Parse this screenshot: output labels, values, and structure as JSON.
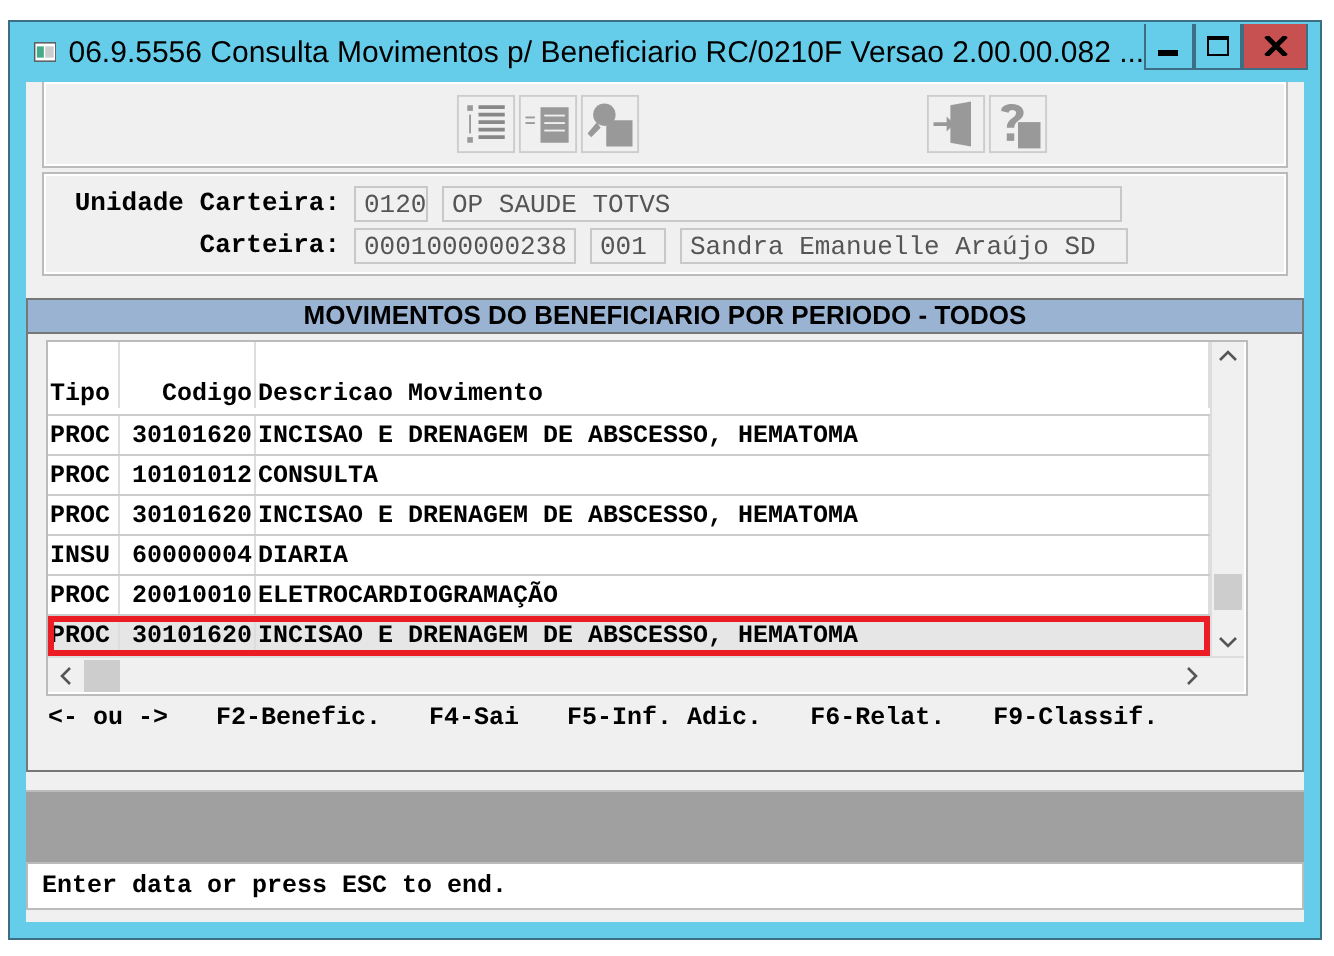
{
  "window": {
    "title": "06.9.5556 Consulta Movimentos p/ Beneficiario RC/0210F Versao 2.00.00.082 ..."
  },
  "fields": [
    {
      "label": "Unidade Carteira:",
      "values": [
        "0120",
        "OP SAUDE TOTVS"
      ]
    },
    {
      "label": "Carteira:",
      "values": [
        "0001000000238",
        "001",
        "Sandra Emanuelle Araújo SD"
      ]
    }
  ],
  "table": {
    "title": "MOVIMENTOS DO BENEFICIARIO POR PERIODO - TODOS",
    "columns": [
      "Tipo",
      "Codigo",
      "Descricao Movimento"
    ],
    "rows": [
      {
        "cells": [
          "PROC",
          "30101620",
          "INCISAO E DRENAGEM DE ABSCESSO, HEMATOMA"
        ],
        "selected": false
      },
      {
        "cells": [
          "PROC",
          "10101012",
          "CONSULTA"
        ],
        "selected": false
      },
      {
        "cells": [
          "PROC",
          "30101620",
          "INCISAO E DRENAGEM DE ABSCESSO, HEMATOMA"
        ],
        "selected": false
      },
      {
        "cells": [
          "INSU",
          "60000004",
          "DIARIA"
        ],
        "selected": false
      },
      {
        "cells": [
          "PROC",
          "20010010",
          "ELETROCARDIOGRAMAÇÃO"
        ],
        "selected": false
      },
      {
        "cells": [
          "PROC",
          "30101620",
          "INCISAO E DRENAGEM DE ABSCESSO, HEMATOMA"
        ],
        "selected": true
      }
    ]
  },
  "function_keys": [
    "<- ou ->",
    "F2-Benefic.",
    "F4-Sai",
    "F5-Inf. Adic.",
    "F6-Relat.",
    "F9-Classif."
  ],
  "status_bar": "Enter data or press ESC to end."
}
